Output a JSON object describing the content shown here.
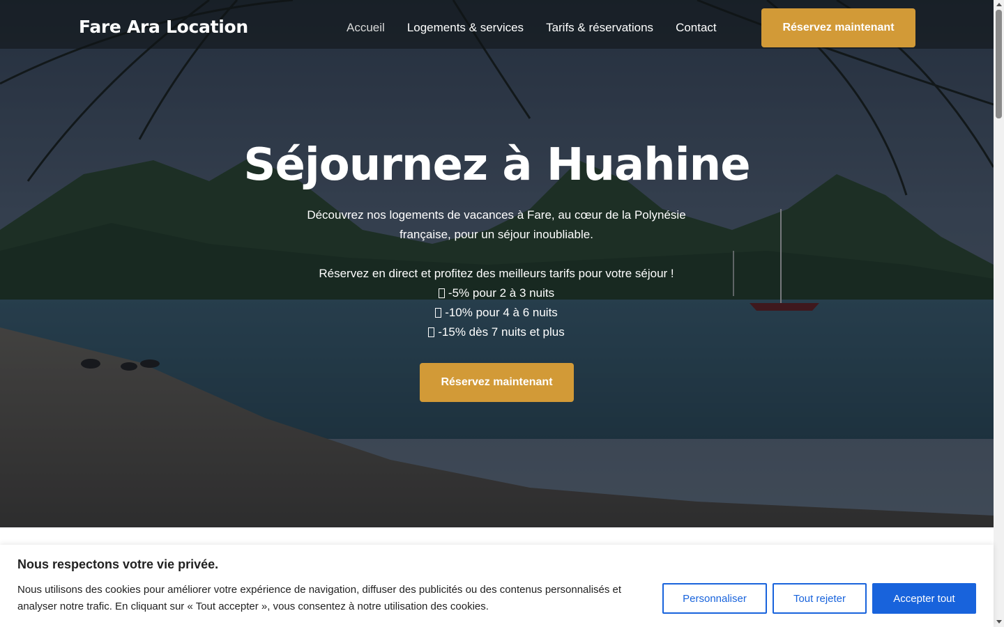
{
  "header": {
    "logo": "Fare Ara Location",
    "nav": [
      "Accueil",
      "Logements & services",
      "Tarifs & réservations",
      "Contact"
    ],
    "cta_label": "Réservez maintenant"
  },
  "hero": {
    "title": "Séjournez à Huahine",
    "intro_line1": "Découvrez nos logements de vacances à Fare, au cœur de la Polynésie",
    "intro_line2": "française, pour un séjour inoubliable.",
    "promo_line": "Réservez en direct et profitez des meilleurs tarifs pour votre séjour !",
    "discounts": [
      "-5% pour 2 à 3 nuits",
      "-10% pour 4 à 6 nuits",
      "-15% dès 7 nuits et plus"
    ],
    "cta_label": "Réservez maintenant"
  },
  "cookie": {
    "title": "Nous respectons votre vie privée.",
    "text_line1": "Nous utilisons des cookies pour améliorer votre expérience de navigation, diffuser des publicités ou des contenus personnalisés et",
    "text_line2": "analyser notre trafic. En cliquant sur « Tout accepter », vous consentez à notre utilisation des cookies.",
    "customize_label": "Personnaliser",
    "reject_label": "Tout rejeter",
    "accept_label": "Accepter tout"
  },
  "colors": {
    "accent_gold": "#d29a37",
    "cookie_blue": "#1863dc"
  }
}
